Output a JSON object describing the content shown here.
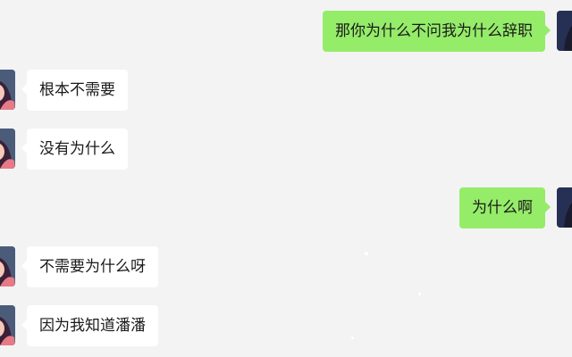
{
  "messages": [
    {
      "side": "right",
      "text": "那你为什么不问我为什么辞职"
    },
    {
      "side": "left",
      "text": "根本不需要"
    },
    {
      "side": "left",
      "text": "没有为什么"
    },
    {
      "side": "right",
      "text": "为什么啊"
    },
    {
      "side": "left",
      "text": "不需要为什么呀"
    },
    {
      "side": "left",
      "text": "因为我知道潘潘"
    }
  ],
  "colors": {
    "background": "#f3f3f3",
    "sent_bubble": "#95ec69",
    "received_bubble": "#ffffff"
  },
  "icons": {
    "sent_avatar": "avatar-icon",
    "received_avatar": "avatar-icon"
  }
}
